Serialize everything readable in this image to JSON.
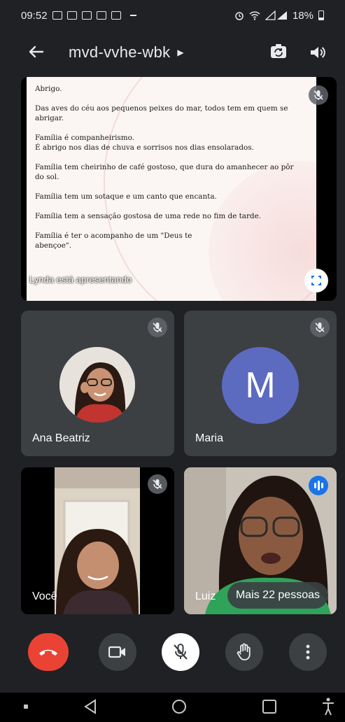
{
  "status_bar": {
    "time": "09:52",
    "battery": "18%"
  },
  "header": {
    "meeting_code": "mvd-vvhe-wbk",
    "back_icon": "arrow-left-icon",
    "switch_camera_icon": "camera-switch-icon",
    "audio_icon": "speaker-icon"
  },
  "presentation": {
    "presenter_label": "Lynda está apresentando",
    "slide_lines": [
      "Abrigo.",
      "Das aves do céu aos pequenos peixes do mar, todos tem em quem se\nabrigar.",
      "Família é companheirismo.\nÉ abrigo nos dias de chuva e sorrisos nos dias ensolarados.",
      "Família tem cheirinho de café gostoso, que dura do amanhecer ao pôr\ndo sol.",
      "Família tem um sotaque e um canto que encanta.",
      "Família tem a sensação gostosa de uma rede no fim de tarde.",
      "Família é ter o acompanho de um \"Deus te\nabençoe\"."
    ]
  },
  "participants": {
    "ana": {
      "name": "Ana Beatriz",
      "muted": true
    },
    "maria": {
      "name": "Maria",
      "initial": "M",
      "muted": true
    },
    "voce": {
      "name": "Você",
      "muted": true
    },
    "luiza": {
      "name": "Luiz",
      "speaking": true
    },
    "more_label": "Mais 22 pessoas"
  },
  "controls": {
    "end_call_icon": "end-call-icon",
    "camera_icon": "video-camera-icon",
    "mic_icon": "mic-off-icon",
    "raise_hand_icon": "hand-icon",
    "more_icon": "more-vertical-icon"
  },
  "colors": {
    "background": "#202124",
    "tile": "#3c4043",
    "end_call": "#ea4335",
    "avatar_maria": "#5c6bc0",
    "speaking_badge": "#1a73e8"
  }
}
